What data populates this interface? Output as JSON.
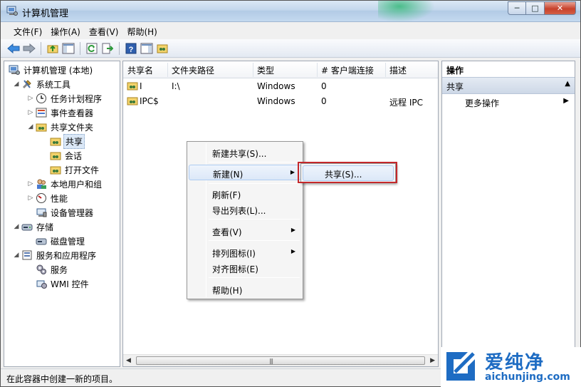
{
  "window": {
    "title": "计算机管理",
    "controls": {
      "minimize": "─",
      "maximize": "□",
      "close": "✕"
    }
  },
  "menubar": {
    "items": [
      "文件(F)",
      "操作(A)",
      "查看(V)",
      "帮助(H)"
    ]
  },
  "toolbar": {
    "icons": [
      "back-icon",
      "forward-icon",
      "up-folder-icon",
      "show-hide-tree-icon",
      "refresh-icon",
      "export-list-icon",
      "help-icon",
      "show-hide-action-pane-icon",
      "new-share-icon"
    ]
  },
  "tree": {
    "root": "计算机管理 (本地)",
    "system_tools": "系统工具",
    "task_scheduler": "任务计划程序",
    "event_viewer": "事件查看器",
    "shared_folders": "共享文件夹",
    "shares": "共享",
    "sessions": "会话",
    "open_files": "打开文件",
    "local_users": "本地用户和组",
    "performance": "性能",
    "device_manager": "设备管理器",
    "storage": "存储",
    "disk_management": "磁盘管理",
    "services_apps": "服务和应用程序",
    "services": "服务",
    "wmi": "WMI 控件"
  },
  "list": {
    "columns": [
      "共享名",
      "文件夹路径",
      "类型",
      "# 客户端连接",
      "描述"
    ],
    "rows": [
      {
        "name": "I",
        "path": "I:\\",
        "type": "Windows",
        "clients": "0",
        "desc": ""
      },
      {
        "name": "IPC$",
        "path": "",
        "type": "Windows",
        "clients": "0",
        "desc": "远程 IPC"
      }
    ]
  },
  "actions": {
    "header": "操作",
    "group": "共享",
    "more": "更多操作"
  },
  "context_menu": {
    "new_share": "新建共享(S)...",
    "new": "新建(N)",
    "refresh": "刷新(F)",
    "export": "导出列表(L)...",
    "view": "查看(V)",
    "arrange": "排列图标(I)",
    "align": "对齐图标(E)",
    "help": "帮助(H)"
  },
  "submenu": {
    "share": "共享(S)..."
  },
  "statusbar": {
    "text": "在此容器中创建一新的项目。"
  },
  "watermark": {
    "brand": "爱纯净",
    "url": "aichunjing.com"
  },
  "colors": {
    "highlight_box": "#c4282b",
    "watermark_blue": "#1e6cc3"
  }
}
